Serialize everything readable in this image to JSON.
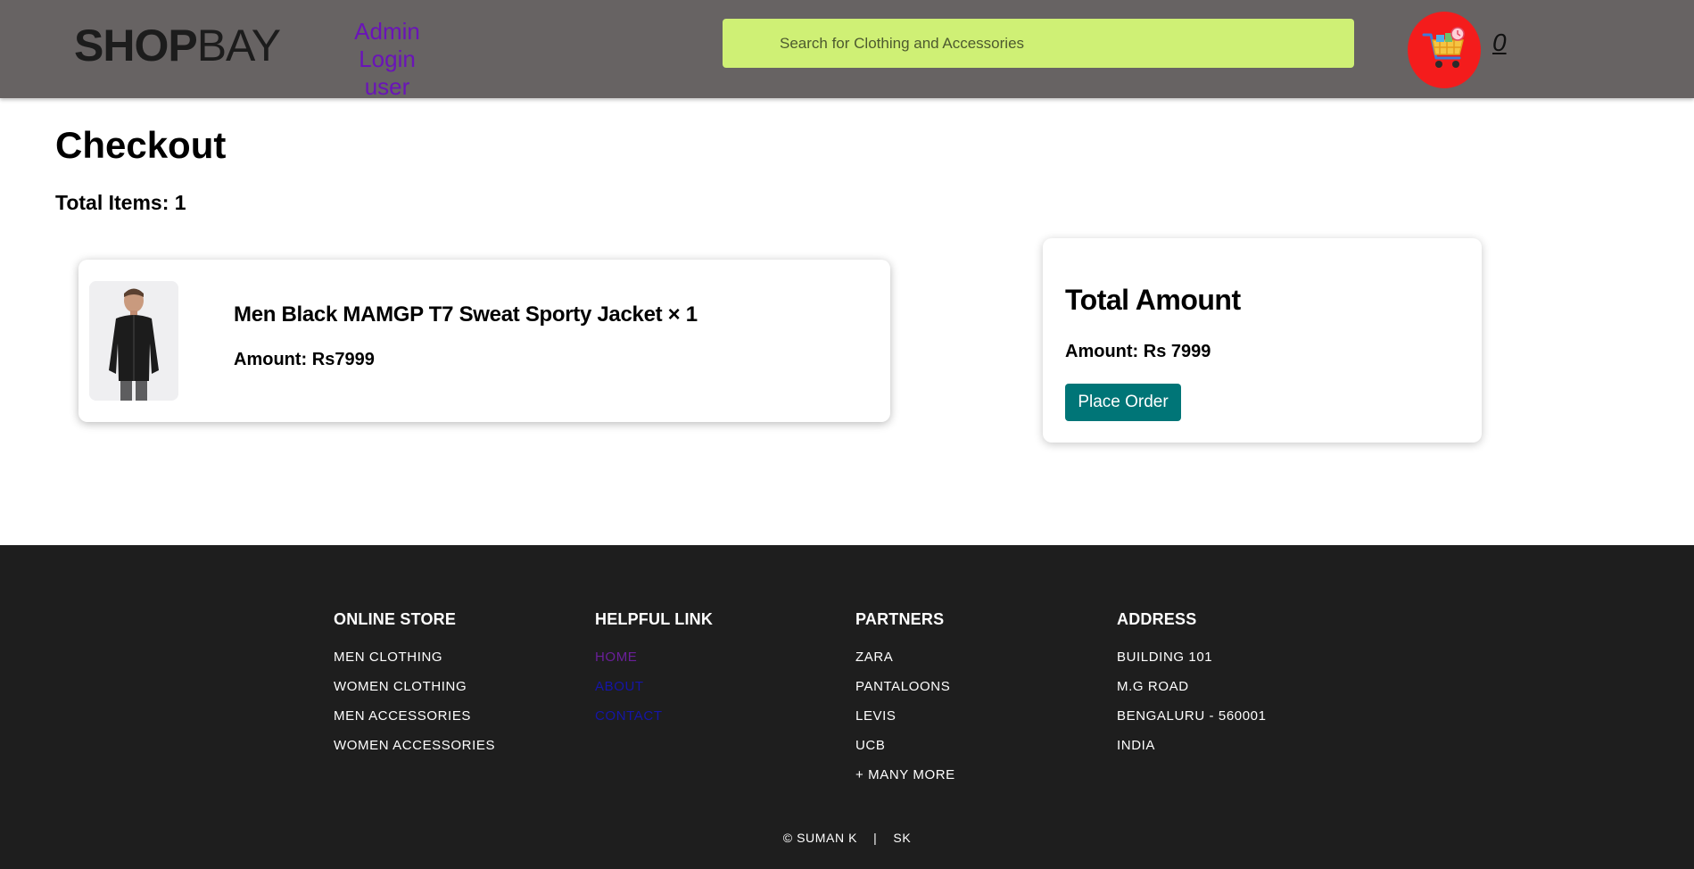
{
  "header": {
    "logo_bold": "SHOP",
    "logo_light": "BAY",
    "admin_label": "Admin",
    "login_label": "Login user",
    "search_placeholder": "Search for Clothing and Accessories",
    "cart_icon": "shopping-cart-icon",
    "cart_count": "0"
  },
  "checkout": {
    "title": "Checkout",
    "total_items": "Total Items: 1",
    "items": [
      {
        "name": "Men Black MAMGP T7 Sweat Sporty Jacket × 1",
        "amount": "Amount: Rs7999",
        "image": "black-jacket-model-photo"
      }
    ],
    "summary": {
      "title": "Total Amount",
      "amount": "Amount: Rs 7999",
      "button_label": "Place Order"
    }
  },
  "footer": {
    "columns": [
      {
        "heading": "ONLINE STORE",
        "items": [
          "MEN CLOTHING",
          "WOMEN CLOTHING",
          "MEN ACCESSORIES",
          "WOMEN ACCESSORIES"
        ]
      },
      {
        "heading": "HELPFUL LINK",
        "items": [
          "HOME",
          "ABOUT",
          "CONTACT"
        ]
      },
      {
        "heading": "PARTNERS",
        "items": [
          "ZARA",
          "PANTALOONS",
          "LEVIS",
          "UCB",
          "+ MANY MORE"
        ]
      },
      {
        "heading": "ADDRESS",
        "items": [
          "BUILDING 101",
          "M.G ROAD",
          "BENGALURU - 560001",
          "INDIA"
        ]
      }
    ],
    "copyright": "© SUMAN K",
    "separator": "|",
    "initials": "SK"
  },
  "colors": {
    "header_bg": "#676363",
    "search_bg": "#cff075",
    "admin_link": "#6a14b8",
    "cart_bg": "#f41c1c",
    "button_bg": "#007577",
    "footer_bg": "#1e1e1e"
  }
}
